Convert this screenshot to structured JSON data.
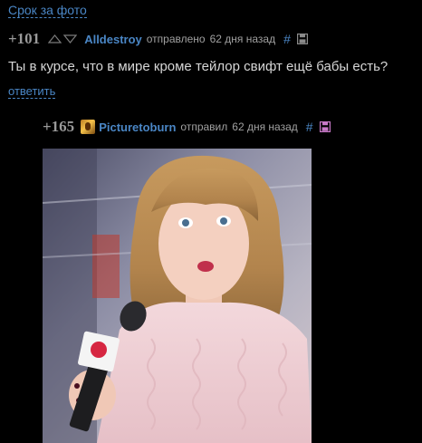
{
  "header": {
    "link_text": "Срок за фото"
  },
  "comment": {
    "score": "+101",
    "username": "Alldestroy",
    "sent_label": "отправлено",
    "time_ago": "62 дня назад",
    "hash": "#",
    "text": "Ты в курсе, что в мире кроме тейлор свифт ещё бабы есть?",
    "reply_label": "ответить"
  },
  "reply": {
    "score": "+165",
    "username": "Picturetoburn",
    "sent_label": "отправил",
    "time_ago": "62 дня назад",
    "hash": "#"
  },
  "icons": {
    "vote_up": "triangle-up-outline-icon",
    "vote_down": "triangle-down-outline-icon",
    "save": "floppy-disk-icon",
    "avatar": "user-avatar-image"
  },
  "colors": {
    "background": "#000000",
    "link": "#4a86c5",
    "score": "#9a9a9a",
    "meta": "#a0a0a0",
    "text": "#d6d6d6",
    "save_reply": "#c879c8"
  }
}
